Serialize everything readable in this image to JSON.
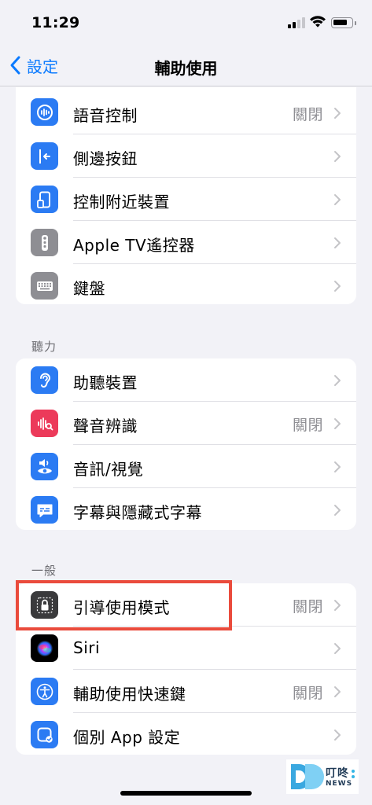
{
  "status_bar": {
    "time": "11:29"
  },
  "nav": {
    "back_label": "設定",
    "title": "輔助使用"
  },
  "colors": {
    "accent": "#0a7aff",
    "highlight": "#ea4b3c",
    "background": "#f2f2f7"
  },
  "groups": [
    {
      "header": "",
      "items": [
        {
          "label": "語音控制",
          "value": "關閉",
          "icon": "voice-control-icon",
          "icon_color": "#2b7bf3"
        },
        {
          "label": "側邊按鈕",
          "value": "",
          "icon": "side-button-icon",
          "icon_color": "#2b7bf3"
        },
        {
          "label": "控制附近裝置",
          "value": "",
          "icon": "nearby-devices-icon",
          "icon_color": "#2b7bf3"
        },
        {
          "label": "Apple TV遙控器",
          "value": "",
          "icon": "apple-tv-remote-icon",
          "icon_color": "#8e8e93"
        },
        {
          "label": "鍵盤",
          "value": "",
          "icon": "keyboard-icon",
          "icon_color": "#8e8e93"
        }
      ]
    },
    {
      "header": "聽力",
      "items": [
        {
          "label": "助聽裝置",
          "value": "",
          "icon": "hearing-device-icon",
          "icon_color": "#2b7bf3"
        },
        {
          "label": "聲音辨識",
          "value": "關閉",
          "icon": "sound-recognition-icon",
          "icon_color": "#ec3a5a"
        },
        {
          "label": "音訊/視覺",
          "value": "",
          "icon": "audio-visual-icon",
          "icon_color": "#2b7bf3"
        },
        {
          "label": "字幕與隱藏式字幕",
          "value": "",
          "icon": "subtitles-icon",
          "icon_color": "#2b7bf3"
        }
      ]
    },
    {
      "header": "一般",
      "items": [
        {
          "label": "引導使用模式",
          "value": "關閉",
          "icon": "guided-access-lock-icon",
          "icon_color": "#3a3a3c"
        },
        {
          "label": "Siri",
          "value": "",
          "icon": "siri-icon",
          "icon_color": "#000000"
        },
        {
          "label": "輔助使用快速鍵",
          "value": "關閉",
          "icon": "accessibility-shortcut-icon",
          "icon_color": "#2b7bf3"
        },
        {
          "label": "個別 App 設定",
          "value": "",
          "icon": "per-app-settings-icon",
          "icon_color": "#2b7bf3"
        }
      ]
    }
  ],
  "watermark": {
    "brand": "叮咚",
    "sub": "NEWS"
  }
}
